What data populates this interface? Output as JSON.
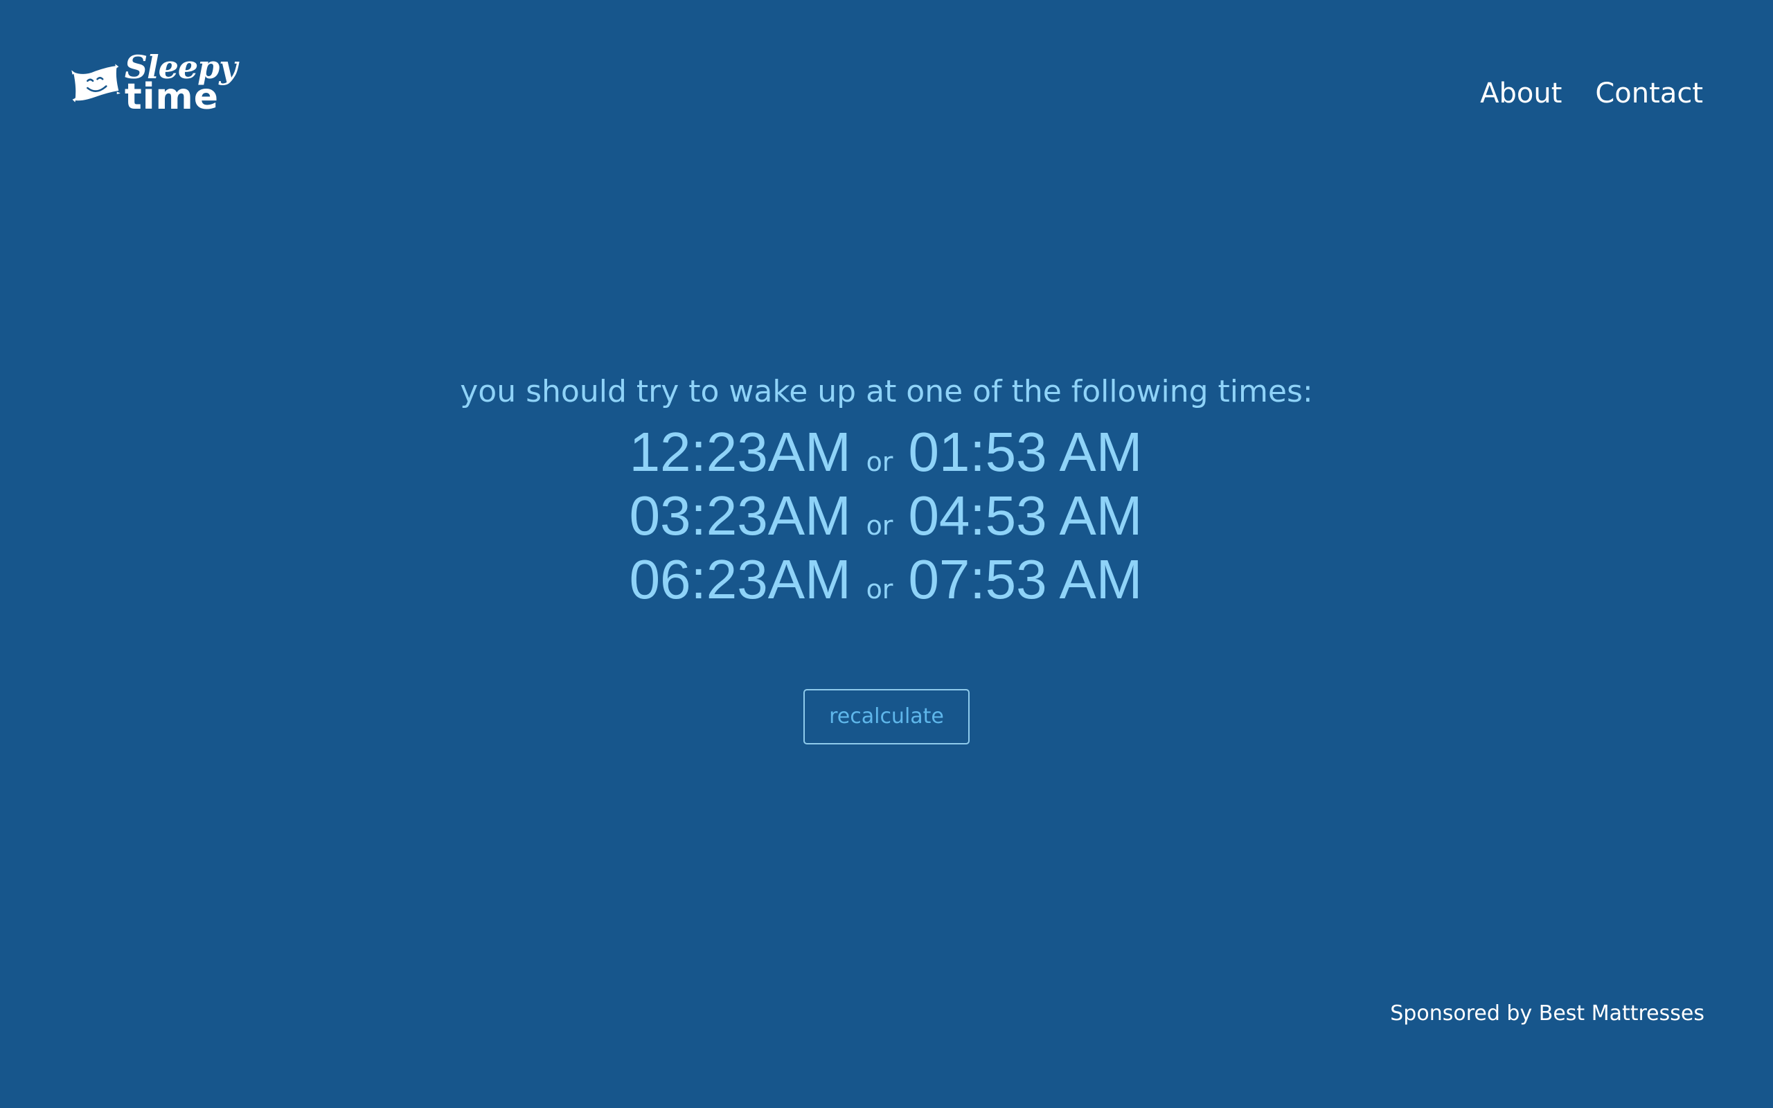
{
  "logo": {
    "line1": "Sleepy",
    "line2": "time",
    "icon": "smiling-pillow-icon"
  },
  "nav": {
    "about": "About",
    "contact": "Contact"
  },
  "main": {
    "intro": "you should try to wake up at one of the following times:",
    "separator": "or",
    "rows": [
      {
        "left": "12:23AM",
        "right": "01:53 AM"
      },
      {
        "left": "03:23AM",
        "right": "04:53 AM"
      },
      {
        "left": "06:23AM",
        "right": "07:53 AM"
      }
    ],
    "recalculate_label": "recalculate"
  },
  "footer": {
    "sponsor": "Sponsored by Best Mattresses"
  },
  "colors": {
    "background": "#17568c",
    "accent": "#8fd3f8",
    "button_text": "#5fb7eb",
    "white": "#ffffff"
  }
}
